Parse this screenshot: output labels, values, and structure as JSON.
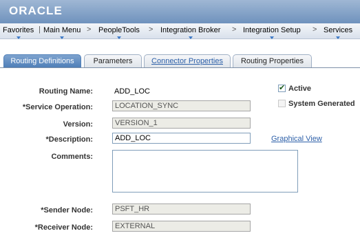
{
  "brand": {
    "logo_text": "ORACLE"
  },
  "nav": {
    "items": [
      {
        "label": "Favorites"
      },
      {
        "label": "Main Menu"
      },
      {
        "label": "PeopleTools"
      },
      {
        "label": "Integration Broker"
      },
      {
        "label": "Integration Setup"
      },
      {
        "label": "Services"
      }
    ],
    "separator": ">"
  },
  "tabs": [
    {
      "label": "Routing Definitions",
      "active": true
    },
    {
      "label": "Parameters",
      "active": false
    },
    {
      "label": "Connector Properties",
      "active": false
    },
    {
      "label": "Routing Properties",
      "active": false
    }
  ],
  "form": {
    "routing_name": {
      "label": "Routing Name:",
      "value": "ADD_LOC"
    },
    "service_operation": {
      "label": "*Service Operation:",
      "value": "LOCATION_SYNC"
    },
    "version": {
      "label": "Version:",
      "value": "VERSION_1"
    },
    "description": {
      "label": "*Description:",
      "value": "ADD_LOC"
    },
    "comments": {
      "label": "Comments:",
      "value": ""
    },
    "sender_node": {
      "label": "*Sender Node:",
      "value": "PSFT_HR"
    },
    "receiver_node": {
      "label": "*Receiver Node:",
      "value": "EXTERNAL"
    },
    "active": {
      "label": "Active",
      "checked": true
    },
    "system_generated": {
      "label": "System Generated",
      "checked": false
    },
    "graphical_view": {
      "label": "Graphical View"
    }
  }
}
